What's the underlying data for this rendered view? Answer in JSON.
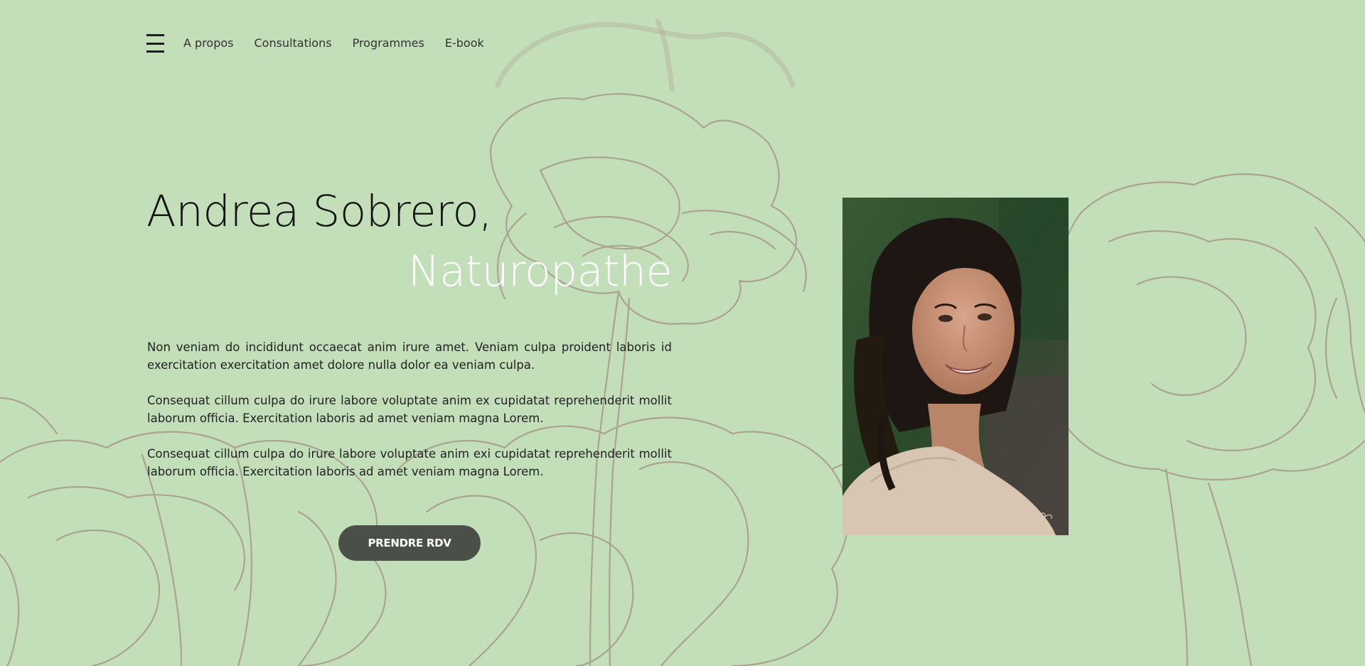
{
  "nav": {
    "menu_icon": "hamburger-icon",
    "links": [
      {
        "label": "A propos"
      },
      {
        "label": "Consultations"
      },
      {
        "label": "Programmes"
      },
      {
        "label": "E-book"
      }
    ]
  },
  "hero": {
    "name": "Andrea Sobrero,",
    "role": "Naturopathe",
    "paragraphs": [
      "Non veniam do incididunt occaecat anim irure amet. Veniam culpa proident laboris id exercitation exercitation amet dolore nulla dolor ea veniam culpa.",
      "Consequat cillum culpa do irure labore voluptate anim ex cupidatat reprehenderit mollit laborum officia. Exercitation laboris ad amet veniam magna Lorem.",
      "Consequat cillum culpa do irure labore voluptate anim exi cupidatat reprehenderit mollit laborum officia. Exercitation laboris ad amet veniam magna Lorem."
    ],
    "cta_label": "PRENDRE RDV"
  },
  "colors": {
    "background": "#c2dfba",
    "line_art": "#aaa391",
    "button": "#4a4f47",
    "role_text": "#ffffff"
  },
  "images": {
    "portrait": "portrait-photo",
    "background": "floral-line-art"
  }
}
